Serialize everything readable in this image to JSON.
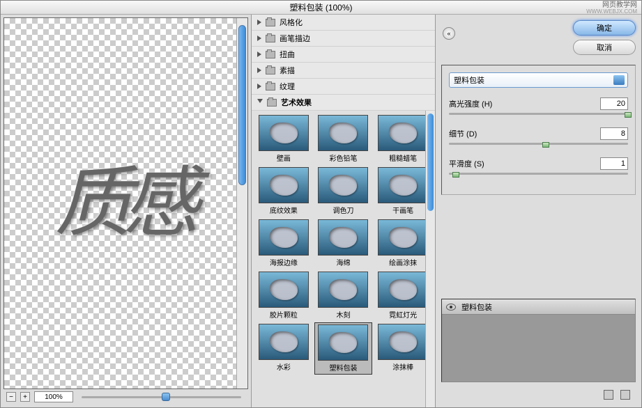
{
  "window": {
    "title": "塑料包装 (100%)"
  },
  "watermark": {
    "main": "网页教学网",
    "sub": "WWW.WEBJX.COM"
  },
  "preview": {
    "text": "质 感",
    "zoom_value": "100%"
  },
  "categories": [
    {
      "label": "风格化",
      "open": false
    },
    {
      "label": "画笔描边",
      "open": false
    },
    {
      "label": "扭曲",
      "open": false
    },
    {
      "label": "素描",
      "open": false
    },
    {
      "label": "纹理",
      "open": false
    },
    {
      "label": "艺术效果",
      "open": true
    }
  ],
  "thumbs": [
    {
      "label": "壁画"
    },
    {
      "label": "彩色铅笔"
    },
    {
      "label": "粗糙蜡笔"
    },
    {
      "label": "底纹效果"
    },
    {
      "label": "调色刀"
    },
    {
      "label": "干画笔"
    },
    {
      "label": "海报边缘"
    },
    {
      "label": "海绵"
    },
    {
      "label": "绘画涂抹"
    },
    {
      "label": "胶片颗粒"
    },
    {
      "label": "木刻"
    },
    {
      "label": "霓虹灯光"
    },
    {
      "label": "水彩"
    },
    {
      "label": "塑料包装",
      "selected": true
    },
    {
      "label": "涂抹棒"
    }
  ],
  "buttons": {
    "ok": "确定",
    "cancel": "取消"
  },
  "dropdown": {
    "value": "塑料包装"
  },
  "sliders": [
    {
      "label": "高光强度 (H)",
      "value": "20",
      "pos": 98
    },
    {
      "label": "细节 (D)",
      "value": "8",
      "pos": 52
    },
    {
      "label": "平滑度 (S)",
      "value": "1",
      "pos": 2
    }
  ],
  "layer": {
    "name": "塑料包装"
  }
}
